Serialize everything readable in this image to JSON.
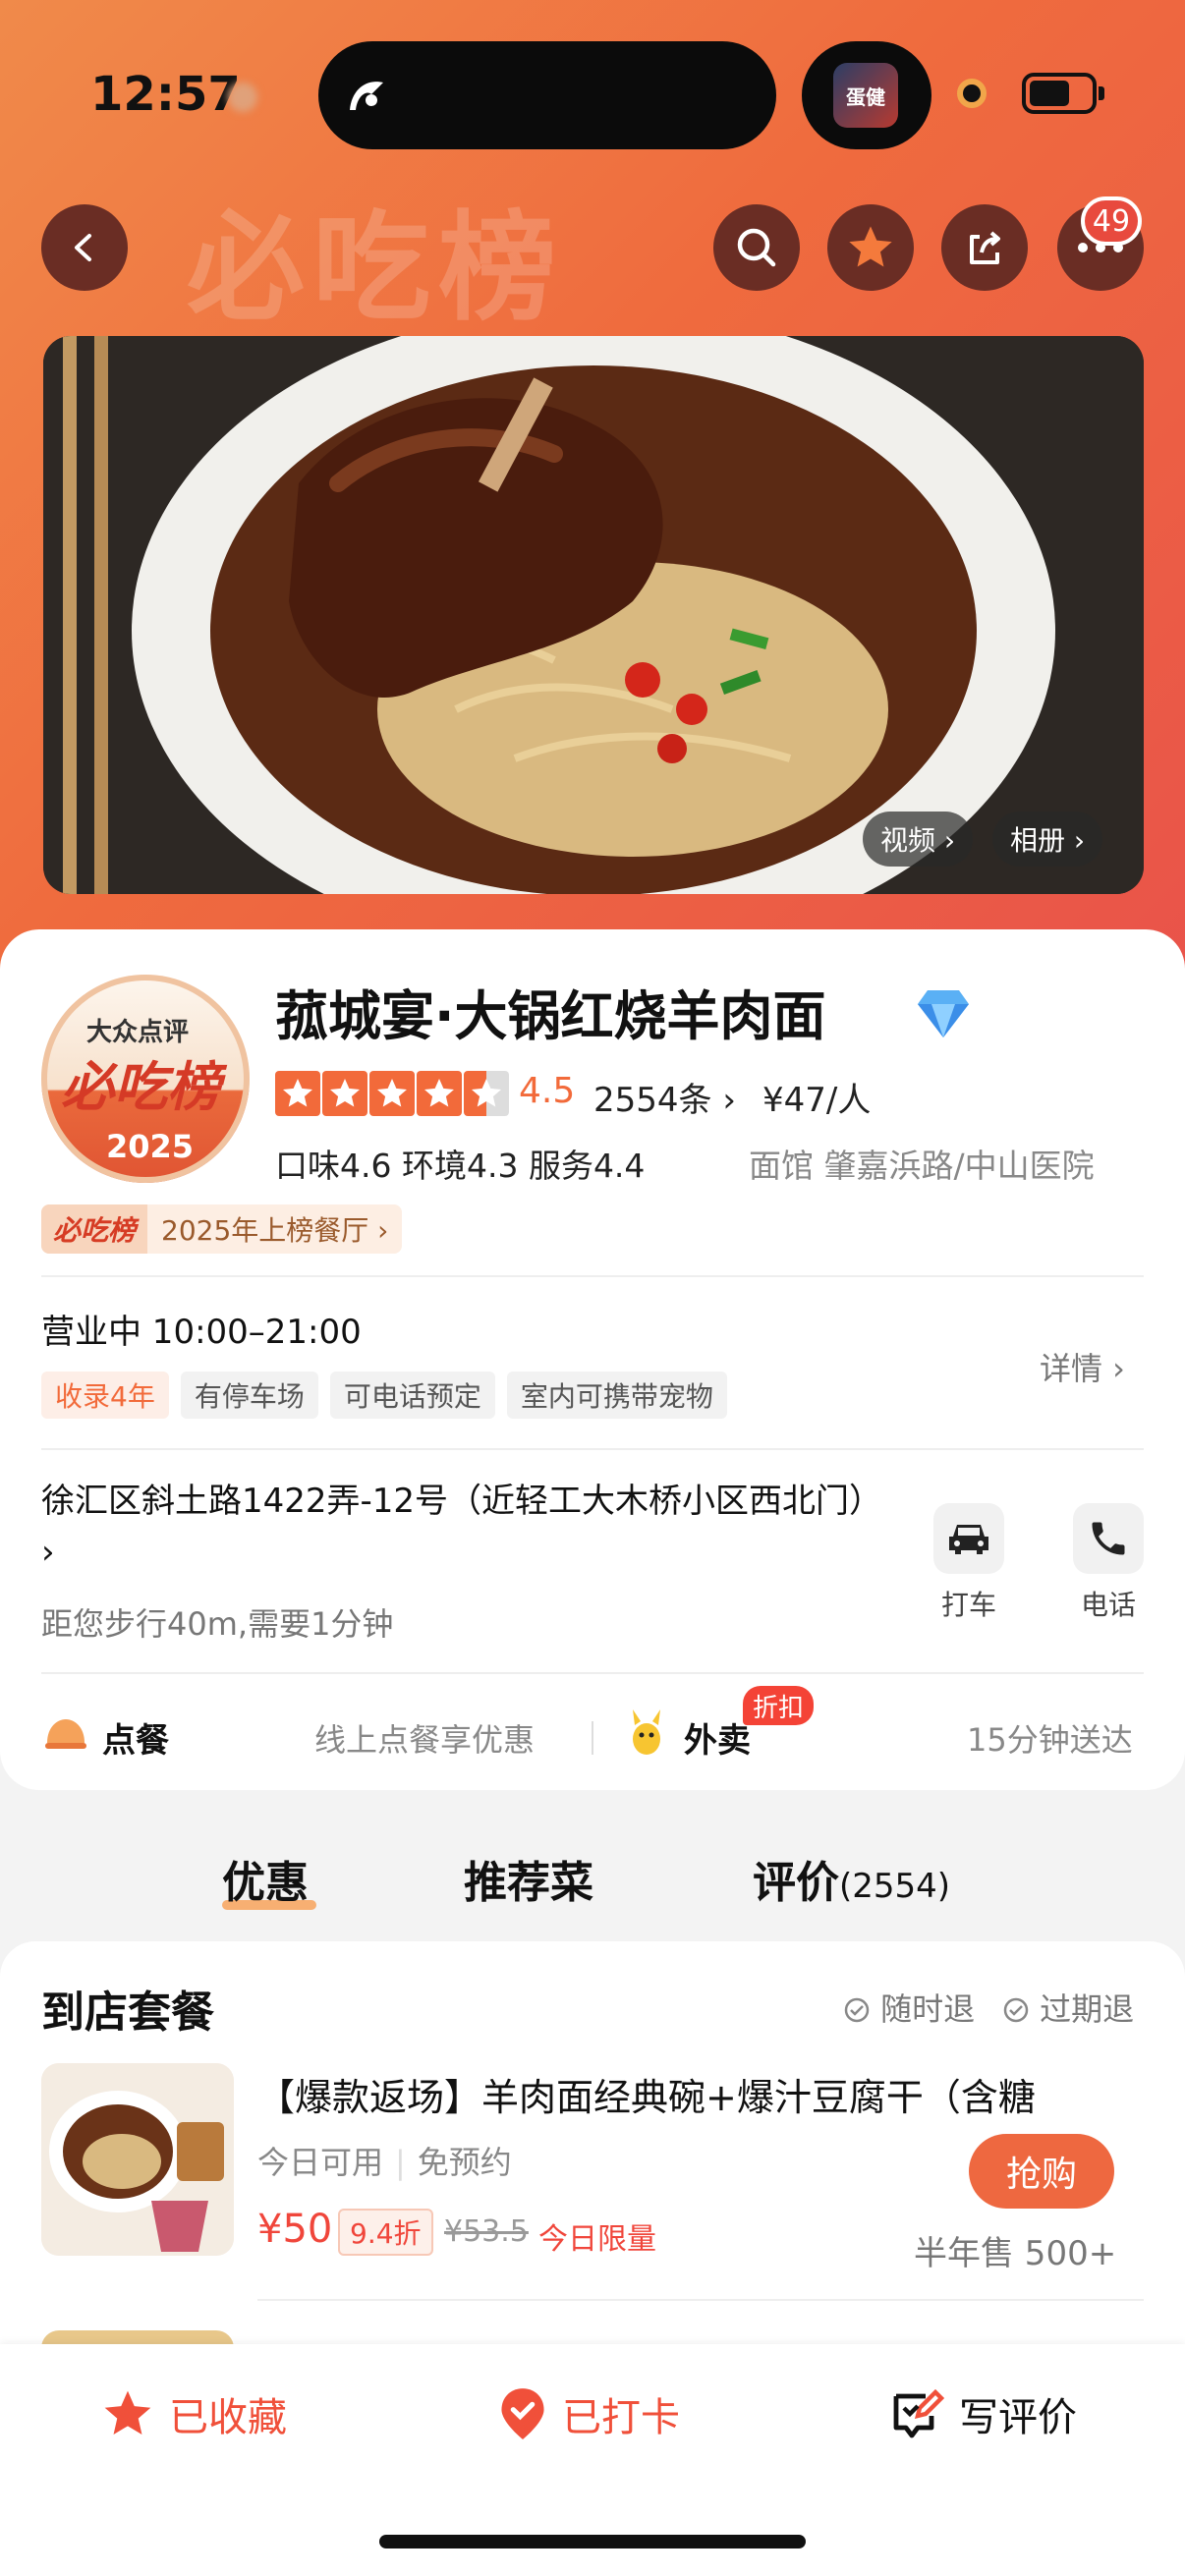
{
  "status_bar": {
    "time": "12:57",
    "live_thumb_text": "蛋健"
  },
  "header": {
    "watermark": "必吃榜",
    "notification_count": "49",
    "icons": [
      "back-icon",
      "search-icon",
      "star-icon",
      "share-icon",
      "more-icon"
    ]
  },
  "photo": {
    "video_label": "视频 ›",
    "album_label": "相册 ›"
  },
  "shop": {
    "logo_line1": "大众点评",
    "logo_line2": "必吃榜",
    "logo_year": "2025",
    "name": "菰城宴·大锅红烧羊肉面",
    "rating": 4.5,
    "score_text": "4.5",
    "review_count": "2554条 ›",
    "price_per_person": "¥47/人",
    "subscores": "口味4.6  环境4.3  服务4.4",
    "category_location": "面馆  肇嘉浜路/中山医院",
    "rank_badge": "必吃榜",
    "rank_text": "2025年上榜餐厅 ›",
    "hours": "营业中  10:00–21:00",
    "tags": [
      {
        "label": "收录4年",
        "highlight": true
      },
      {
        "label": "有停车场",
        "highlight": false
      },
      {
        "label": "可电话预定",
        "highlight": false
      },
      {
        "label": "室内可携带宠物",
        "highlight": false
      }
    ],
    "detail_link": "详情 ›",
    "address": "徐汇区斜土路1422弄-12号（近轻工大木桥小区西北门） ›",
    "distance": "距您步行40m,需要1分钟",
    "actions": [
      {
        "label": "打车",
        "icon": "car-icon"
      },
      {
        "label": "电话",
        "icon": "phone-icon"
      }
    ],
    "order": {
      "label": "点餐",
      "desc": "线上点餐享优惠"
    },
    "takeout": {
      "label": "外卖",
      "badge": "折扣",
      "desc": "15分钟送达"
    }
  },
  "tabs": [
    {
      "label": "优惠",
      "active": true
    },
    {
      "label": "推荐菜",
      "active": false
    },
    {
      "label": "评价",
      "count": "(2554)",
      "active": false
    }
  ],
  "deals": {
    "section_title": "到店套餐",
    "flags": [
      "随时退",
      "过期退"
    ],
    "items": [
      {
        "name": "【爆款返场】羊肉面经典碗+爆汁豆腐干（含糖",
        "availability": "今日可用",
        "booking": "免预约",
        "price": "¥50",
        "discount": "9.4折",
        "original_price": "¥53.5",
        "limit": "今日限量",
        "buy_label": "抢购",
        "sold": "半年售 500+"
      }
    ]
  },
  "bottom_bar": {
    "favorite": "已收藏",
    "checkin": "已打卡",
    "review": "写评价"
  },
  "colors": {
    "accent": "#f26a3a",
    "price_red": "#f0463b",
    "header_start": "#f08a4a",
    "header_end": "#e9534a"
  }
}
